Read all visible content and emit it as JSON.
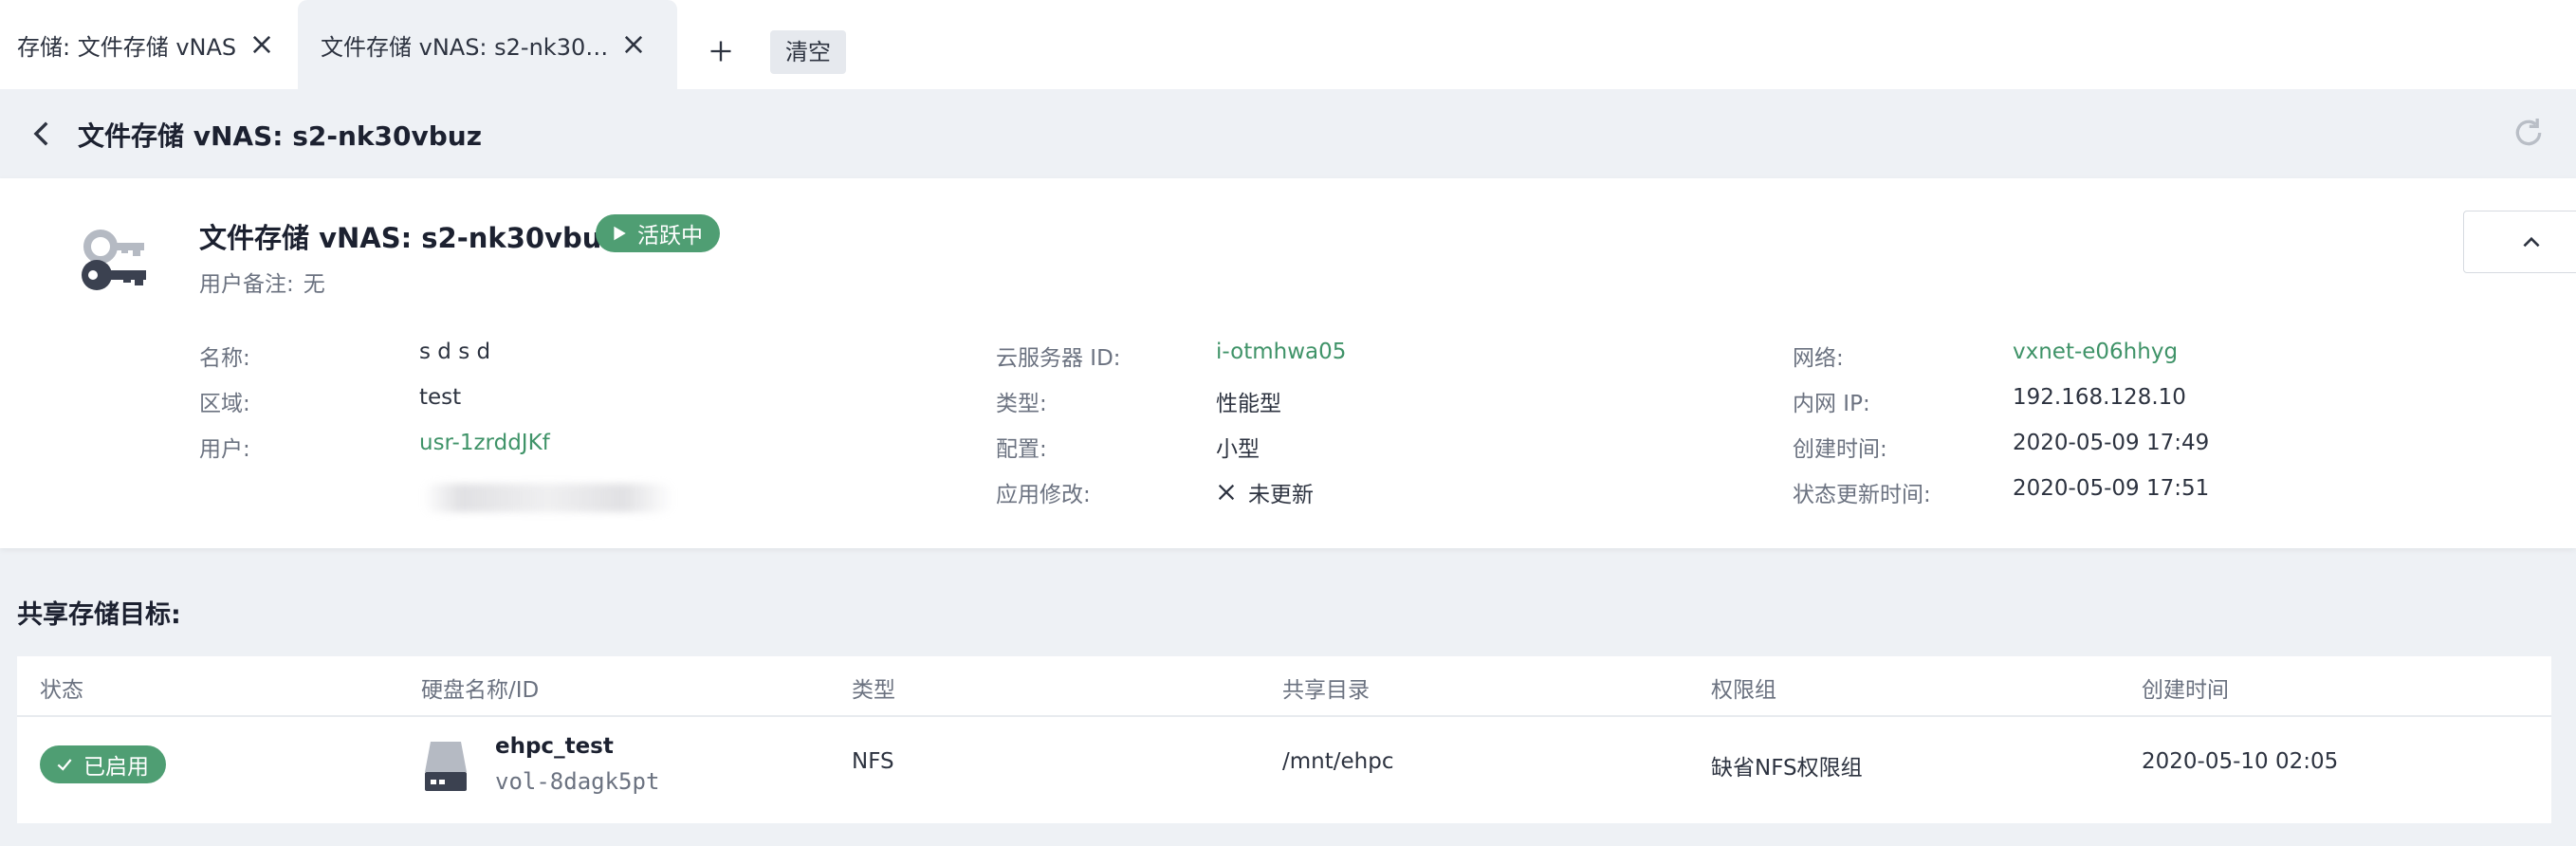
{
  "tabs": [
    {
      "label": "存储: 文件存储 vNAS"
    },
    {
      "label": "文件存储 vNAS: s2-nk30vbuz"
    }
  ],
  "tabbar": {
    "clear_label": "清空"
  },
  "header": {
    "title": "文件存储 vNAS: s2-nk30vbuz"
  },
  "resource": {
    "title": "文件存储 vNAS: s2-nk30vbuz",
    "status": "活跃中",
    "remark_label": "用户备注:",
    "remark_value": "无"
  },
  "info": {
    "col1": [
      {
        "label": "名称:",
        "value": "s d s d"
      },
      {
        "label": "区域:",
        "value": "test"
      },
      {
        "label": "用户:",
        "value": "usr-1zrddJKf"
      }
    ],
    "col2": [
      {
        "label": "云服务器 ID:",
        "value": "i-otmhwa05"
      },
      {
        "label": "类型:",
        "value": "性能型"
      },
      {
        "label": "配置:",
        "value": "小型"
      },
      {
        "label": "应用修改:",
        "value": "未更新"
      }
    ],
    "col3": [
      {
        "label": "网络:",
        "value": "vxnet-e06hhyg"
      },
      {
        "label": "内网 IP:",
        "value": "192.168.128.10"
      },
      {
        "label": "创建时间:",
        "value": "2020-05-09 17:49"
      },
      {
        "label": "状态更新时间:",
        "value": "2020-05-09 17:51"
      }
    ]
  },
  "targets": {
    "section_title": "共享存储目标:",
    "columns": [
      "状态",
      "硬盘名称/ID",
      "类型",
      "共享目录",
      "权限组",
      "创建时间"
    ],
    "rows": [
      {
        "status": "已启用",
        "disk_name": "ehpc_test",
        "disk_id": "vol-8dagk5pt",
        "type": "NFS",
        "share_dir": "/mnt/ehpc",
        "perm_group": "缺省NFS权限组",
        "created": "2020-05-10 02:05"
      }
    ]
  },
  "colors": {
    "accent_green": "#4f9e73",
    "link_green": "#3f9368",
    "background": "#eef1f5"
  },
  "icons": {
    "tab_close": "close-icon",
    "tab_add": "plus-icon",
    "back": "chevron-left-icon",
    "refresh": "refresh-icon",
    "resource": "keys-icon",
    "status": "play-icon",
    "collapse": "chevron-up-icon",
    "not_updated": "close-icon",
    "enabled": "check-icon",
    "disk": "disk-icon"
  }
}
